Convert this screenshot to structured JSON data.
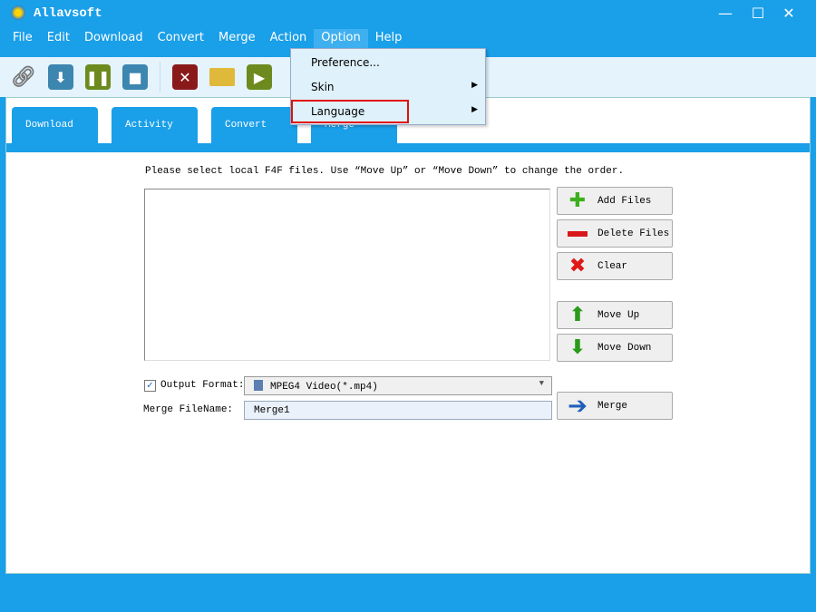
{
  "window": {
    "title": "Allavsoft",
    "controls": {
      "minimize": "—",
      "maximize": "☐",
      "close": "✕"
    }
  },
  "menu": [
    "File",
    "Edit",
    "Download",
    "Convert",
    "Merge",
    "Action",
    "Option",
    "Help"
  ],
  "toolbar": {
    "icons": [
      "add-url-icon",
      "download-icon",
      "pause-icon",
      "stop-icon",
      "delete-icon",
      "open-folder-icon",
      "play-icon"
    ]
  },
  "tabs": [
    "Download",
    "Activity",
    "Convert",
    "Merge"
  ],
  "active_tab": "Merge",
  "merge": {
    "instructions": "Please select local F4F files. Use “Move Up” or “Move Down” to change the order.",
    "buttons": {
      "add": "Add Files",
      "delete": "Delete Files",
      "clear": "Clear",
      "move_up": "Move Up",
      "move_down": "Move Down",
      "merge": "Merge"
    },
    "output_format_label": "Output Format:",
    "output_format_checked": true,
    "output_format_value": "MPEG4 Video(*.mp4)",
    "filename_label": "Merge FileName:",
    "filename_value": "Merge1"
  },
  "option_menu": {
    "items": [
      {
        "label": "Preference..."
      },
      {
        "label": "Skin",
        "submenu": true
      },
      {
        "label": "Language",
        "submenu": true,
        "highlighted": true
      }
    ]
  },
  "colors": {
    "window_blue": "#1a9fe9",
    "highlight_red": "#e01010"
  }
}
